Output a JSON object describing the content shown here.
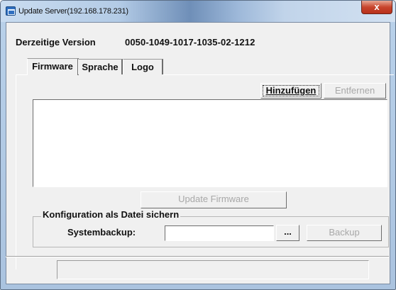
{
  "window": {
    "title": "Update Server(192.168.178.231)",
    "close_label": "x"
  },
  "version": {
    "label": "Derzeitige Version",
    "value": "0050-1049-1017-1035-02-1212"
  },
  "tabs": [
    {
      "label": "Firmware",
      "selected": true
    },
    {
      "label": "Sprache",
      "selected": false
    },
    {
      "label": "Logo",
      "selected": false
    }
  ],
  "firmware": {
    "add_label": "Hinzufügen",
    "remove_label": "Entfernen",
    "update_label": "Update Firmware"
  },
  "backup": {
    "group_label": "Konfiguration als Datei sichern",
    "systembackup_label": "Systembackup:",
    "path_value": "",
    "browse_label": "...",
    "backup_label": "Backup"
  },
  "status": {
    "text": ""
  }
}
